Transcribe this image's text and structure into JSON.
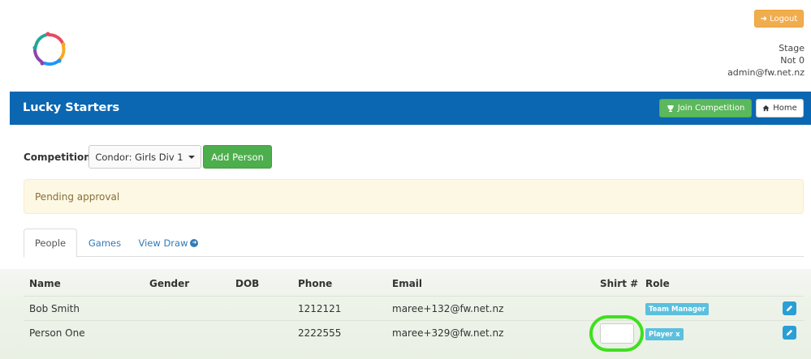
{
  "header": {
    "logout_label": "Logout",
    "user_lines": [
      "Stage",
      "Not 0",
      "admin@fw.net.nz"
    ]
  },
  "navbar": {
    "title": "Lucky Starters",
    "join_label": "Join Competition",
    "home_label": "Home",
    "bg_color": "#0b67b1"
  },
  "competition": {
    "label": "Competition:",
    "selected": "Condor: Girls Div 1",
    "add_person_label": "Add Person"
  },
  "alert": {
    "text": "Pending approval"
  },
  "tabs": [
    {
      "label": "People",
      "active": true
    },
    {
      "label": "Games",
      "active": false
    },
    {
      "label": "View Draw",
      "active": false
    }
  ],
  "table": {
    "columns": [
      "Name",
      "Gender",
      "DOB",
      "Phone",
      "Email",
      "Shirt #",
      "Role"
    ],
    "rows": [
      {
        "name": "Bob Smith",
        "gender": "",
        "dob": "",
        "phone": "1212121",
        "email": "maree+132@fw.net.nz",
        "shirt": "",
        "role": "Team Manager"
      },
      {
        "name": "Person One",
        "gender": "",
        "dob": "",
        "phone": "2222555",
        "email": "maree+329@fw.net.nz",
        "shirt": "",
        "role": "Player x"
      }
    ]
  },
  "icons": {
    "logout": "sign-out-icon",
    "join": "trophy-icon",
    "home": "home-icon",
    "view_draw": "circle-arrow-right-icon",
    "edit": "pencil-icon"
  }
}
